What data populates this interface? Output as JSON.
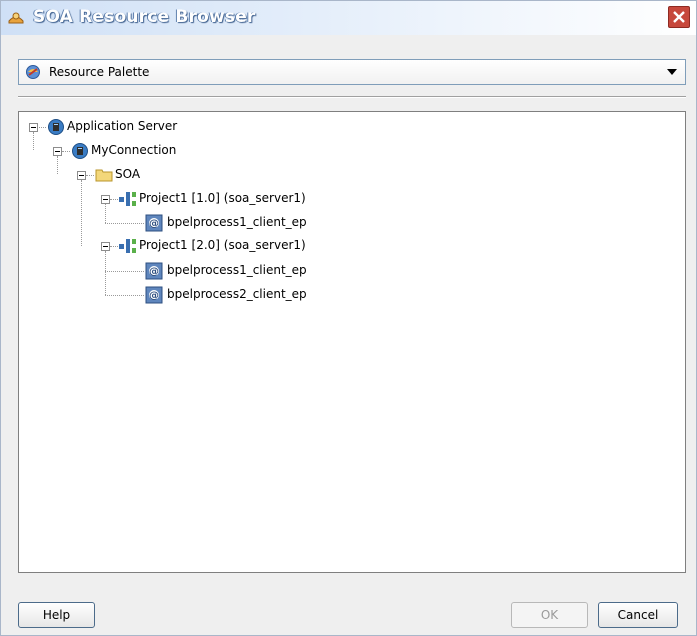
{
  "window": {
    "title": "SOA Resource Browser"
  },
  "palette": {
    "selected": "Resource Palette"
  },
  "tree": {
    "root": "Application Server",
    "connection": "MyConnection",
    "folder": "SOA",
    "project1": "Project1 [1.0] (soa_server1)",
    "project1_child1": "bpelprocess1_client_ep",
    "project2": "Project1 [2.0] (soa_server1)",
    "project2_child1": "bpelprocess1_client_ep",
    "project2_child2": "bpelprocess2_client_ep"
  },
  "buttons": {
    "help": "Help",
    "ok": "OK",
    "cancel": "Cancel"
  }
}
